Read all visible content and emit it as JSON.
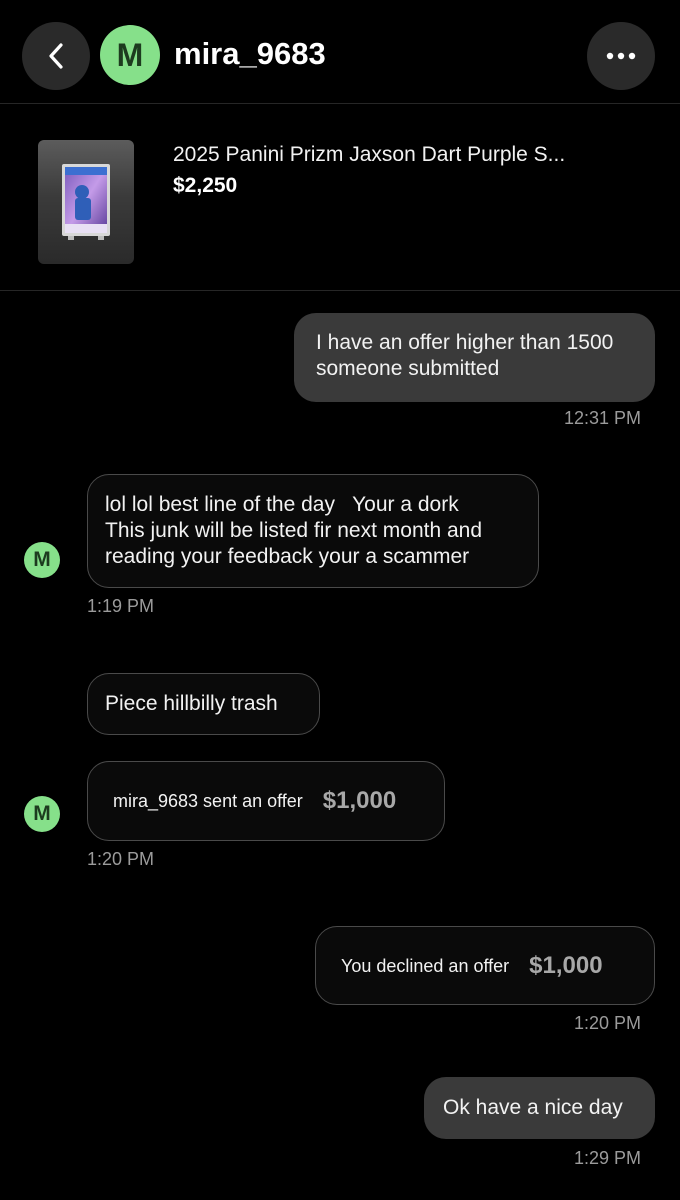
{
  "header": {
    "avatar_letter": "M",
    "username": "mira_9683"
  },
  "listing": {
    "title": "2025 Panini Prizm Jaxson Dart Purple S...",
    "price": "$2,250"
  },
  "messages": [
    {
      "direction": "sent",
      "lines": [
        "I have an offer higher than 1500",
        "someone submitted"
      ],
      "time": "12:31 PM"
    },
    {
      "direction": "received",
      "lines": [
        "lol lol best line of the day   Your a dork",
        "This junk will be listed fir next month and",
        "reading your feedback your a scammer"
      ],
      "time": "1:19 PM"
    },
    {
      "direction": "received",
      "lines": [
        "Piece hillbilly trash"
      ]
    },
    {
      "direction": "received",
      "type": "offer",
      "label": "mira_9683 sent an offer",
      "amount": "$1,000",
      "time": "1:20 PM"
    },
    {
      "direction": "sent",
      "type": "offer",
      "label": "You declined an offer",
      "amount": "$1,000",
      "time": "1:20 PM"
    },
    {
      "direction": "sent",
      "lines": [
        "Ok have a nice day"
      ],
      "time": "1:29 PM"
    }
  ],
  "colors": {
    "background": "#000000",
    "avatar": "#86e08a",
    "sent_bubble": "#3a3a3a",
    "received_border": "#4a4a4a",
    "timestamp": "#9b9b9b"
  }
}
